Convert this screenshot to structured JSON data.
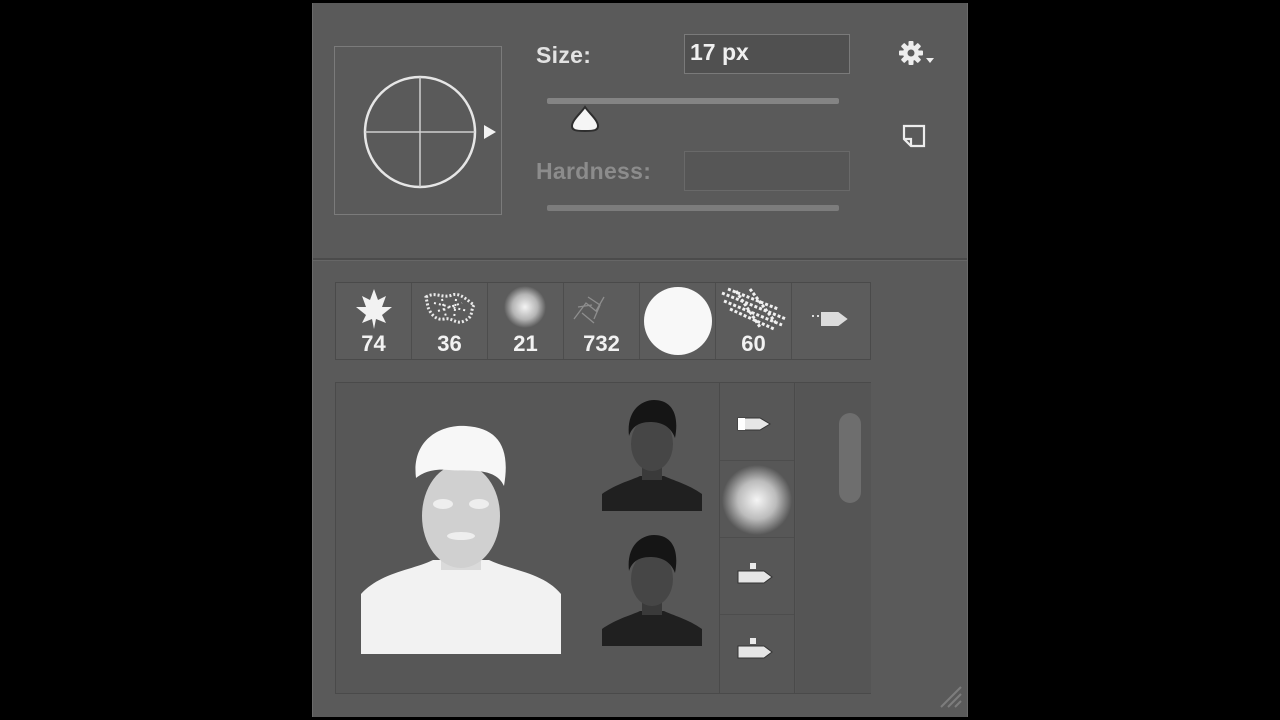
{
  "size": {
    "label": "Size:",
    "value": "17 px",
    "slider_fraction": 0.13
  },
  "hardness": {
    "label": "Hardness:",
    "value": "",
    "disabled": true
  },
  "icons": {
    "settings": "gear-icon",
    "new_preset": "new-preset-icon",
    "resize": "resize-grip-icon",
    "preview_arrow": "triangle-right-icon"
  },
  "recent_brushes": [
    {
      "name": "leaf",
      "size": "74"
    },
    {
      "name": "scatter-1",
      "size": "36"
    },
    {
      "name": "soft-round",
      "size": "21"
    },
    {
      "name": "sketch",
      "size": "732"
    },
    {
      "name": "hard-round",
      "size": ""
    },
    {
      "name": "scatter-2",
      "size": "60"
    },
    {
      "name": "tip-1",
      "size": ""
    }
  ],
  "colors": {
    "panel": "#5a5a5a",
    "text": "#e2e2e2",
    "disabled_text": "#8c8c8c",
    "field_bg": "#505050"
  }
}
